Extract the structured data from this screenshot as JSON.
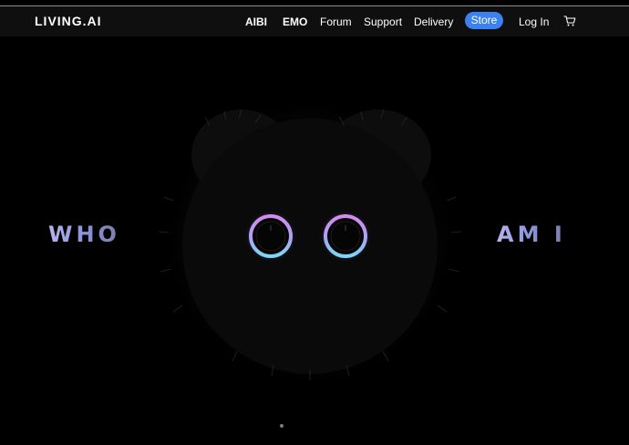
{
  "nav": {
    "logo": "LIVING.AI",
    "items": [
      {
        "label": "AIBI",
        "bold": true
      },
      {
        "label": "EMO",
        "bold": true
      },
      {
        "label": "Forum",
        "bold": false
      },
      {
        "label": "Support",
        "bold": false
      },
      {
        "label": "Delivery",
        "bold": false
      }
    ],
    "store": "Store",
    "login": "Log In",
    "cart_icon": "cart-icon"
  },
  "hero": {
    "left_word": "WHO",
    "right_word": "AM I"
  },
  "colors": {
    "navbar_bg": "#0f0f0f",
    "store_button": "#3b82f0",
    "eye_ring_top": "#d48af0",
    "eye_ring_bottom": "#7fd6f5",
    "text_gradient_start": "#b6b3ef",
    "text_gradient_end": "#7a7fa8"
  }
}
